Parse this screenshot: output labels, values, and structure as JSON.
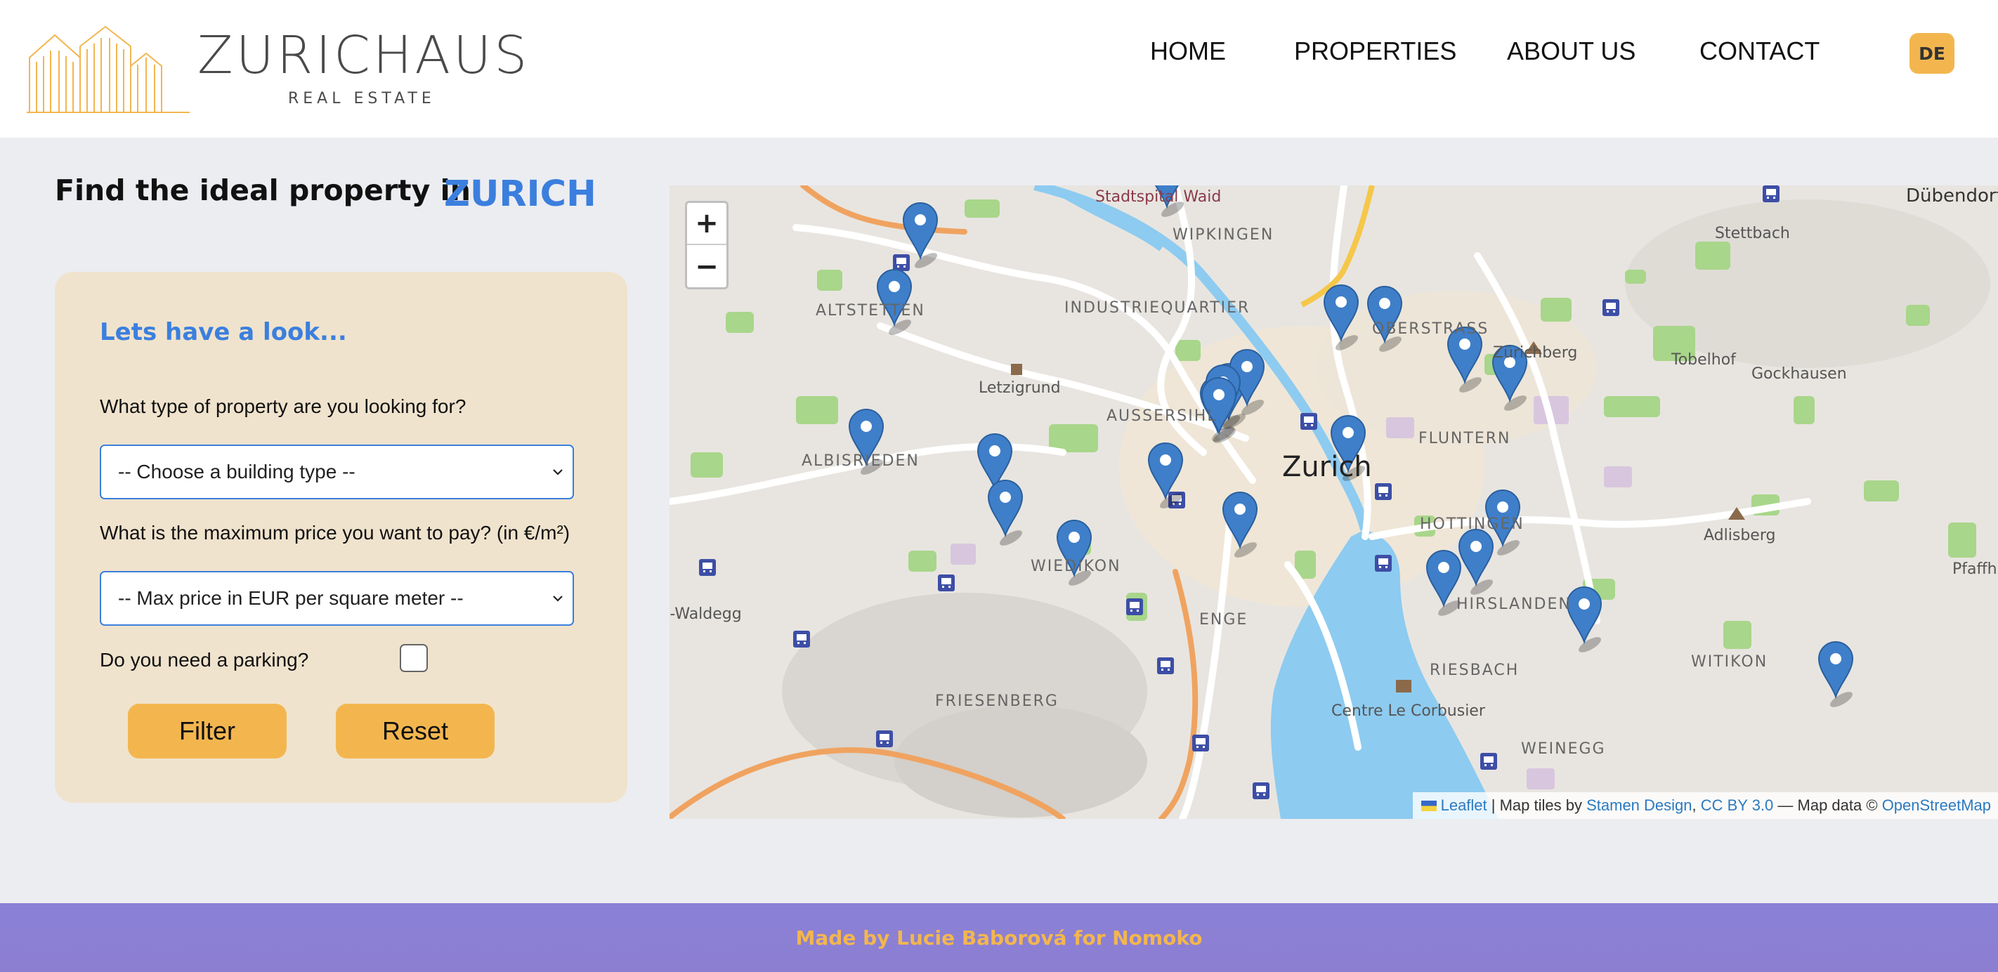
{
  "brand": {
    "name": "ZURICHAUS",
    "subtitle": "REAL ESTATE"
  },
  "nav": {
    "items": [
      "HOME",
      "PROPERTIES",
      "ABOUT US",
      "CONTACT"
    ],
    "language": "DE"
  },
  "headline": {
    "text": "Find the ideal property in",
    "city": "ZURICH"
  },
  "filter": {
    "title": "Lets have a look...",
    "type_question": "What type of property are you looking for?",
    "type_select": "-- Choose a building type --",
    "price_question": "What is the maximum price you want to pay? (in €/m²)",
    "price_select": "-- Max price in EUR per square meter --",
    "parking_question": "Do you need a parking?",
    "parking_checked": false,
    "filter_button": "Filter",
    "reset_button": "Reset"
  },
  "map": {
    "zoom_in": "+",
    "zoom_out": "−",
    "city_label": "Zurich",
    "district_labels": [
      "WIPKINGEN",
      "INDUSTRIEQUARTIER",
      "ALTSTETTEN",
      "AUSSERSIHL",
      "ALBISRIEDEN",
      "FLUNTERN",
      "HOTTINGEN",
      "HIRSLANDEN",
      "WIEDIKON",
      "ENGE",
      "FRIESENBERG",
      "WITIKON",
      "WEINEGG",
      "RIESBACH",
      "OBERSTRASS"
    ],
    "place_labels": [
      "Stadtspital Waid",
      "Letzigrund",
      "Zürichberg",
      "Adlisberg",
      "Centre Le Corbusier",
      "Stettbach",
      "Tobelhof",
      "Gockhausen",
      "Dübendorf",
      "Pfaffhausen",
      "Uitikon-Waldegg"
    ],
    "marker_count": 26,
    "attribution": {
      "leaflet": "Leaflet",
      "sep1": " | Map tiles by ",
      "stamen": "Stamen Design",
      "comma": ", ",
      "license": "CC BY 3.0",
      "sep2": " — Map data © ",
      "osm": "OpenStreetMap"
    }
  },
  "footer": {
    "text": "Made by Lucie Baborová for Nomoko"
  },
  "colors": {
    "accent": "#3b7fde",
    "button": "#f3b64f",
    "card": "#f0e3cd",
    "footer": "#8a80d6",
    "marker": "#3f7fc9"
  }
}
